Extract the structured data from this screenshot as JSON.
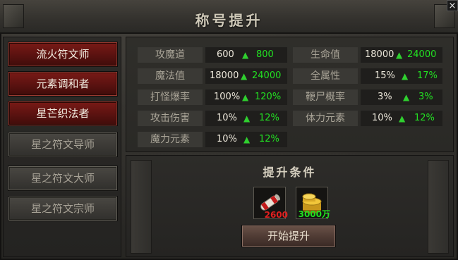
{
  "window": {
    "title": "称号提升",
    "close_label": "×"
  },
  "titles": [
    {
      "label": "流火符文师",
      "state": "active"
    },
    {
      "label": "元素调和者",
      "state": "active"
    },
    {
      "label": "星芒织法者",
      "state": "active"
    },
    {
      "label": "星之符文导师",
      "state": "locked"
    },
    {
      "label": "星之符文大师",
      "state": "locked"
    },
    {
      "label": "星之符文宗师",
      "state": "locked"
    }
  ],
  "stats": [
    {
      "label": "攻魔道",
      "current": "600",
      "next": "800"
    },
    {
      "label": "生命值",
      "current": "18000",
      "next": "24000"
    },
    {
      "label": "魔法值",
      "current": "18000",
      "next": "24000"
    },
    {
      "label": "全属性",
      "current": "15%",
      "next": "17%"
    },
    {
      "label": "打怪爆率",
      "current": "100%",
      "next": "120%"
    },
    {
      "label": "鞭尸概率",
      "current": "3%",
      "next": "3%"
    },
    {
      "label": "攻击伤害",
      "current": "10%",
      "next": "12%"
    },
    {
      "label": "体力元素",
      "current": "10%",
      "next": "12%"
    },
    {
      "label": "魔力元素",
      "current": "10%",
      "next": "12%"
    }
  ],
  "conditions": {
    "title": "提升条件",
    "items": [
      {
        "icon": "scroll-icon",
        "qty": "2600",
        "qty_color": "#e02020"
      },
      {
        "icon": "gold-coins-icon",
        "qty": "3000万",
        "qty_color": "#20e020"
      }
    ],
    "start_label": "开始提升"
  },
  "colors": {
    "active_title": "#6a1512",
    "increase_green": "#22e022",
    "cost_red": "#e02020"
  }
}
